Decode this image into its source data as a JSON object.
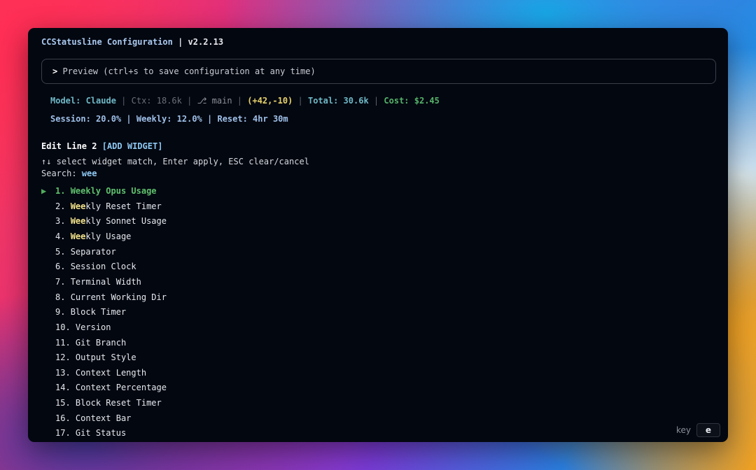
{
  "window": {
    "title_name": "CCStatusline Configuration",
    "title_sep": " | ",
    "title_version": "v2.2.13"
  },
  "preview": {
    "caret": ">",
    "text": " Preview (ctrl+s to save configuration at any time)"
  },
  "statusline": {
    "line1": {
      "model": "Model: Claude",
      "ctx": "Ctx: 18.6k",
      "branch_icon": "⎇",
      "branch": "main",
      "changes": "(+42,-10)",
      "total": "Total: 30.6k",
      "cost": "Cost: $2.45",
      "separator": "|"
    },
    "line2": {
      "session": "Session: 20.0%",
      "weekly": "Weekly: 12.0%",
      "reset": "Reset: 4hr 30m",
      "separator": "|"
    }
  },
  "editor": {
    "heading": "Edit Line 2",
    "mode_tag": "[ADD WIDGET]",
    "hint": "↑↓ select widget match, Enter apply, ESC clear/cancel",
    "search_label": "Search: ",
    "search_value": "wee"
  },
  "widgets": [
    {
      "num": "1.",
      "match": "Weekly",
      "rest": " Opus Usage",
      "selected": true
    },
    {
      "num": "2.",
      "match": "Wee",
      "rest": "kly Reset Timer",
      "selected": false
    },
    {
      "num": "3.",
      "match": "Wee",
      "rest": "kly Sonnet Usage",
      "selected": false
    },
    {
      "num": "4.",
      "match": "Wee",
      "rest": "kly Usage",
      "selected": false
    },
    {
      "num": "5.",
      "match": "",
      "rest": "Separator",
      "selected": false
    },
    {
      "num": "6.",
      "match": "",
      "rest": "Session Clock",
      "selected": false
    },
    {
      "num": "7.",
      "match": "",
      "rest": "Terminal Width",
      "selected": false
    },
    {
      "num": "8.",
      "match": "",
      "rest": "Current Working Dir",
      "selected": false
    },
    {
      "num": "9.",
      "match": "",
      "rest": "Block Timer",
      "selected": false
    },
    {
      "num": "10.",
      "match": "",
      "rest": "Version",
      "selected": false
    },
    {
      "num": "11.",
      "match": "",
      "rest": "Git Branch",
      "selected": false
    },
    {
      "num": "12.",
      "match": "",
      "rest": "Output Style",
      "selected": false
    },
    {
      "num": "13.",
      "match": "",
      "rest": "Context Length",
      "selected": false
    },
    {
      "num": "14.",
      "match": "",
      "rest": "Context Percentage",
      "selected": false
    },
    {
      "num": "15.",
      "match": "",
      "rest": "Block Reset Timer",
      "selected": false
    },
    {
      "num": "16.",
      "match": "",
      "rest": "Context Bar",
      "selected": false
    },
    {
      "num": "17.",
      "match": "",
      "rest": "Git Status",
      "selected": false
    }
  ],
  "selection_pointer": "▶",
  "key_hint": {
    "label": "key",
    "key": "e"
  },
  "icons": {
    "branch": "git-branch-icon",
    "pointer": "triangle-right-icon"
  },
  "colors": {
    "terminal_bg": "#030710",
    "selected": "#5fc06d",
    "match_highlight": "#f4e38a",
    "accent_blue": "#8ec8f2",
    "model_teal": "#6fb8c6",
    "cost_green": "#55b36a",
    "changes_yellow": "#e8d36a"
  }
}
